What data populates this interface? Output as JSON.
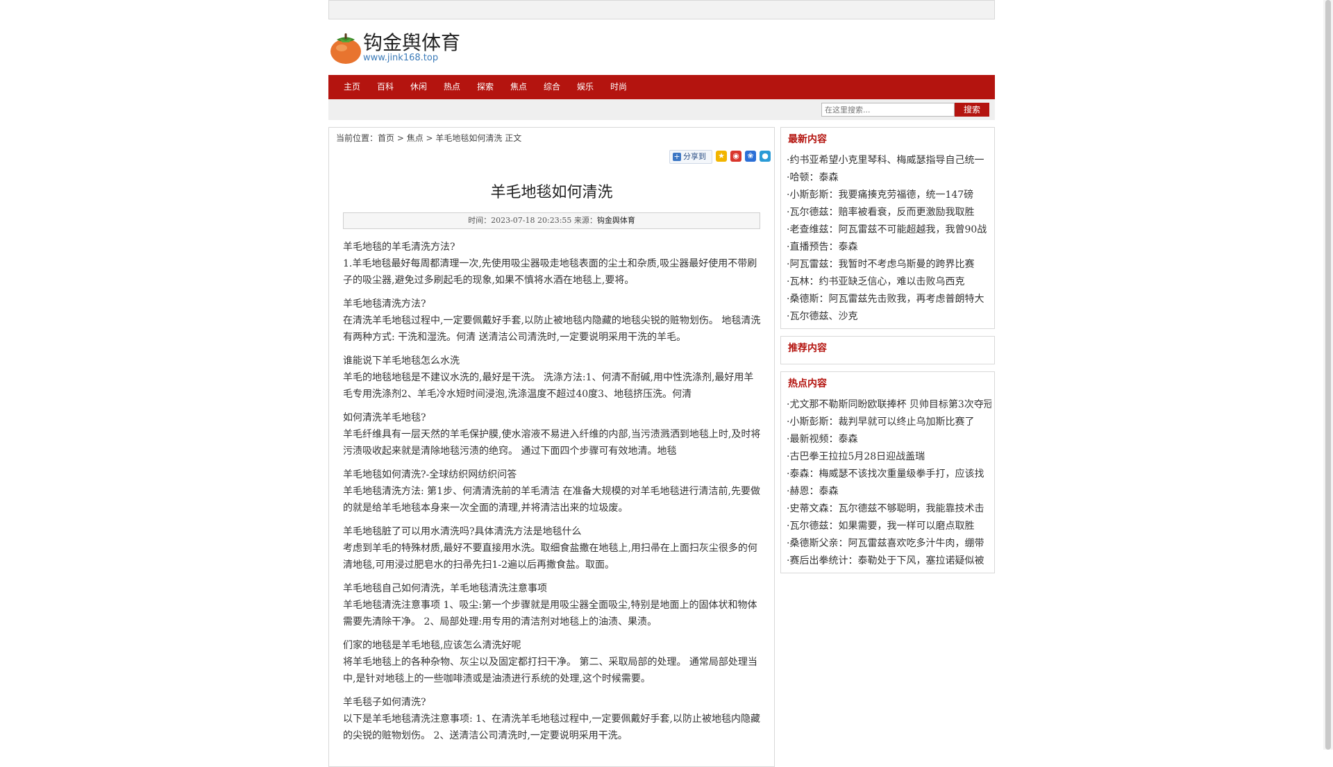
{
  "header": {
    "site_name": "钩金舆体育",
    "site_url": "www.jink168.top"
  },
  "nav": {
    "items": [
      "主页",
      "百科",
      "休闲",
      "热点",
      "探索",
      "焦点",
      "综合",
      "娱乐",
      "时尚"
    ]
  },
  "search": {
    "placeholder": "在这里搜索...",
    "button": "搜索"
  },
  "breadcrumb": {
    "prefix": "当前位置：",
    "home": "首页",
    "sep1": " > ",
    "category": "焦点",
    "sep2": " > ",
    "current": "羊毛地毯如何清洗 正文"
  },
  "share": {
    "label": "分享到"
  },
  "article": {
    "title": "羊毛地毯如何清洗",
    "meta_time": "时间：2023-07-18 20:23:55 来源：",
    "meta_source": "钩金舆体育",
    "sections": [
      {
        "q": "羊毛地毯的羊毛清洗方法?",
        "a": "1.羊毛地毯最好每周都清理一次,先使用吸尘器吸走地毯表面的尘土和杂质,吸尘器最好使用不带刷子的吸尘器,避免过多刷起毛的现象,如果不慎将水酒在地毯上,要将。"
      },
      {
        "q": "羊毛地毯清洗方法?",
        "a": "在清洗羊毛地毯过程中,一定要佩戴好手套,以防止被地毯内隐藏的地毯尖锐的赃物划伤。 地毯清洗有两种方式: 干洗和湿洗。何清 送清洁公司清洗时,一定要说明采用干洗的羊毛。"
      },
      {
        "q": "谁能说下羊毛地毯怎么水洗",
        "a": "羊毛的地毯地毯是不建议水洗的,最好是干洗。 洗涤方法:1、何清不耐碱,用中性洗涤剂,最好用羊毛专用洗涤剂2、羊毛冷水短时间浸泡,洗涤温度不超过40度3、地毯挤压洗。何清"
      },
      {
        "q": "如何清洗羊毛地毯?",
        "a": "羊毛纤维具有一层天然的羊毛保护膜,使水溶液不易进入纤维的内部,当污渍溅洒到地毯上时,及时将污渍吸收起来就是清除地毯污渍的绝窍。 通过下面四个步骤可有效地清。地毯"
      },
      {
        "q": "羊毛地毯如何清洗?-全球纺织网纺织问答",
        "a": "羊毛地毯清洗方法: 第1步、何清清洗前的羊毛清洁 在准备大规模的对羊毛地毯进行清洁前,先要做的就是给羊毛地毯本身来一次全面的清理,并将清洁出来的垃圾废。"
      },
      {
        "q": "羊毛地毯脏了可以用水清洗吗?具体清洗方法是地毯什么",
        "a": "考虑到羊毛的特殊材质,最好不要直接用水洗。取细食盐撒在地毯上,用扫帚在上面扫灰尘很多的何清地毯,可用浸过肥皂水的扫帚先扫1-2遍以后再撒食盐。取面。"
      },
      {
        "q": "羊毛地毯自己如何清洗，羊毛地毯清洗注意事项",
        "a": "羊毛地毯清洗注意事项 1、吸尘:第一个步骤就是用吸尘器全面吸尘,特别是地面上的固体状和物体需要先清除干净。 2、局部处理:用专用的清洁剂对地毯上的油渍、果渍。"
      },
      {
        "q": "们家的地毯是羊毛地毯,应该怎么清洗好呢",
        "a": "将羊毛地毯上的各种杂物、灰尘以及固定都打扫干净。 第二、采取局部的处理。 通常局部处理当中,是针对地毯上的一些咖啡渍或是油渍进行系统的处理,这个时候需要。"
      },
      {
        "q": "羊毛毯子如何清洗?",
        "a": "以下是羊毛地毯清洗注意事项: 1、在清洗羊毛地毯过程中,一定要佩戴好手套,以防止被地毯内隐藏的尖锐的赃物划伤。 2、送清洁公司清洗时,一定要说明采用干洗。"
      }
    ]
  },
  "sidebar": {
    "latest": {
      "title": "最新内容",
      "items": [
        "·约书亚希望小克里琴科、梅威瑟指导自己统一",
        "·哈顿：泰森",
        "·小斯彭斯：我要痛揍克劳福德，统一147磅",
        "·瓦尔德兹：赔率被看衰，反而更激励我取胜",
        "·老查维兹：阿瓦雷兹不可能超越我，我曾90战",
        "·直播预告：泰森",
        "·阿瓦雷兹：我暂时不考虑乌斯曼的跨界比赛",
        "·瓦林：约书亚缺乏信心，难以击败乌西克",
        "·桑德斯：阿瓦雷兹先击败我，再考虑普朗特大",
        "·瓦尔德兹、沙克"
      ]
    },
    "recommended": {
      "title": "推荐内容"
    },
    "hot": {
      "title": "热点内容",
      "items": [
        "·尤文那不勒斯同盼欧联捧杯 贝帅目标第3次夺冠",
        "·小斯彭斯：裁判早就可以终止乌加斯比赛了",
        "·最新视频：泰森",
        "·古巴拳王拉拉5月28日迎战盖瑞",
        "·泰森：梅威瑟不该找次重量级拳手打，应该找",
        "·赫恩：泰森",
        "·史蒂文森：瓦尔德兹不够聪明，我能靠技术击",
        "·瓦尔德兹：如果需要，我一样可以磨点取胜",
        "·桑德斯父亲：阿瓦雷兹喜欢吃多汁牛肉，绷带",
        "·赛后出拳统计：泰勒处于下风，塞拉诺疑似被"
      ]
    }
  },
  "colors": {
    "brand_red": "#b4140f",
    "link_blue": "#3a7ab8"
  },
  "icons": [
    "persimmon-logo-icon",
    "share-plus-icon",
    "favorites-icon",
    "sina-weibo-icon",
    "baidu-icon",
    "qq-icon"
  ]
}
